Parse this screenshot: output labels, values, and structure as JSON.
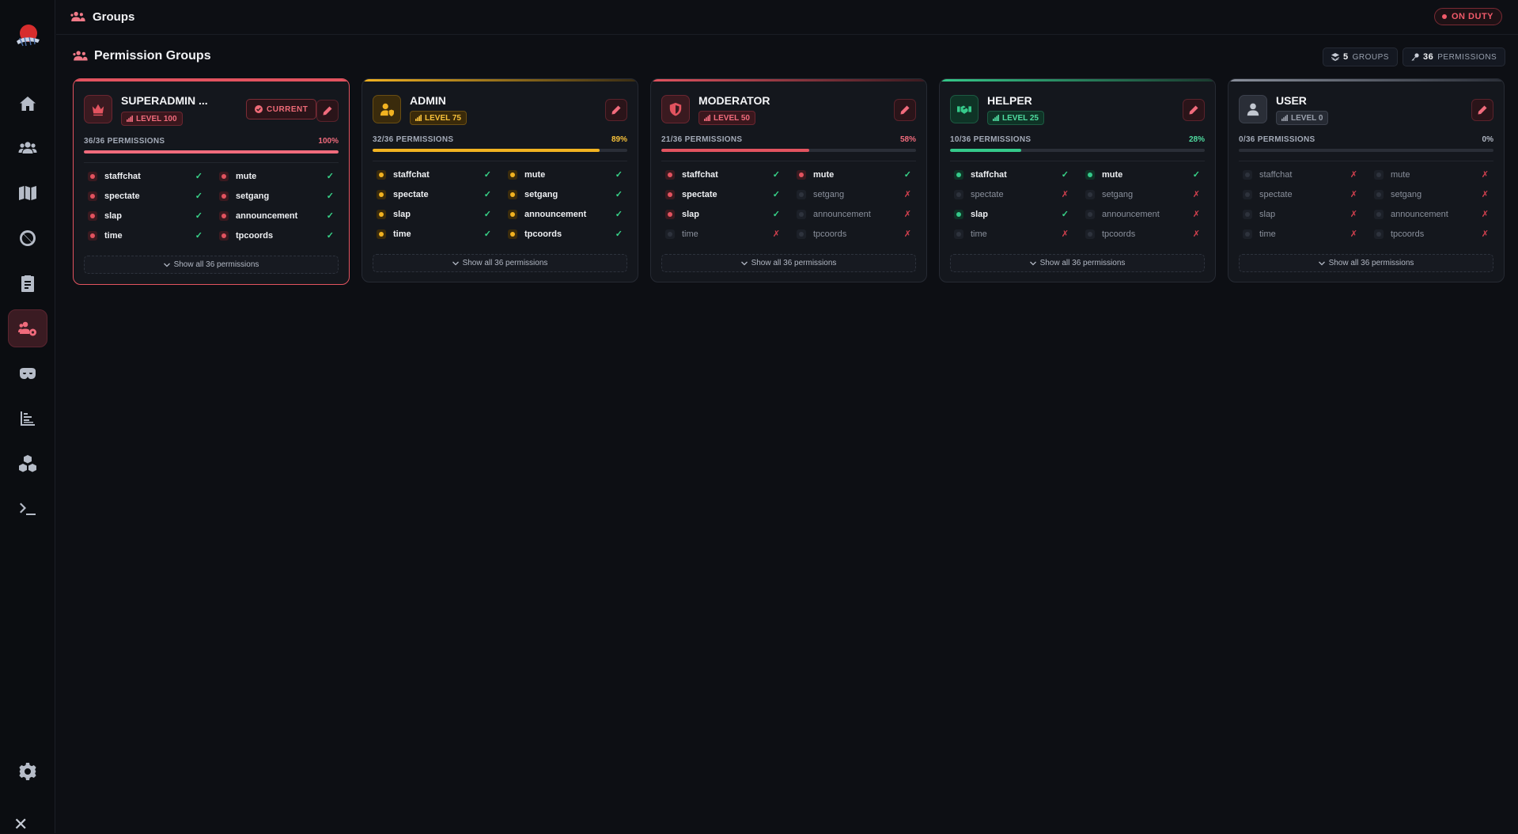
{
  "topbar": {
    "title": "Groups",
    "duty_label": "ON DUTY"
  },
  "section": {
    "title": "Permission Groups"
  },
  "stats": {
    "groups_count": "5",
    "groups_label": "GROUPS",
    "permissions_count": "36",
    "permissions_label": "PERMISSIONS"
  },
  "colors": {
    "accent": "#e2535f",
    "admin": "#f2b321",
    "moderator": "#e2535f",
    "helper": "#35c98a",
    "user": "#8a909c",
    "check": "#38d489",
    "cross": "#d2404e"
  },
  "sidebar": {
    "items": [
      {
        "icon": "home-icon"
      },
      {
        "icon": "users-icon"
      },
      {
        "icon": "map-icon"
      },
      {
        "icon": "ban-icon"
      },
      {
        "icon": "clipboard-icon"
      },
      {
        "icon": "user-group-cog-icon",
        "active": true
      },
      {
        "icon": "mask-icon"
      },
      {
        "icon": "chart-bar-icon"
      },
      {
        "icon": "cubes-icon"
      },
      {
        "icon": "terminal-icon"
      },
      {
        "icon": "gear-icon"
      }
    ]
  },
  "show_all_label": "Show all 36 permissions",
  "groups": [
    {
      "name": "SUPERADMIN ...",
      "level": "LEVEL 100",
      "current_label": "CURRENT",
      "perm_count": "36/36 PERMISSIONS",
      "percent": "100%",
      "fill": 1.0,
      "perms": [
        {
          "name": "staffchat",
          "on": true,
          "mark": "✓"
        },
        {
          "name": "mute",
          "on": true,
          "mark": "✓"
        },
        {
          "name": "spectate",
          "on": true,
          "mark": "✓"
        },
        {
          "name": "setgang",
          "on": true,
          "mark": "✓"
        },
        {
          "name": "slap",
          "on": true,
          "mark": "✓"
        },
        {
          "name": "announcement",
          "on": true,
          "mark": "✓"
        },
        {
          "name": "time",
          "on": true,
          "mark": "✓"
        },
        {
          "name": "tpcoords",
          "on": true,
          "mark": "✓"
        }
      ]
    },
    {
      "name": "ADMIN",
      "level": "LEVEL 75",
      "perm_count": "32/36 PERMISSIONS",
      "percent": "89%",
      "fill": 0.89,
      "perms": [
        {
          "name": "staffchat",
          "on": true,
          "mark": "✓"
        },
        {
          "name": "mute",
          "on": true,
          "mark": "✓"
        },
        {
          "name": "spectate",
          "on": true,
          "mark": "✓"
        },
        {
          "name": "setgang",
          "on": true,
          "mark": "✓"
        },
        {
          "name": "slap",
          "on": true,
          "mark": "✓"
        },
        {
          "name": "announcement",
          "on": true,
          "mark": "✓"
        },
        {
          "name": "time",
          "on": true,
          "mark": "✓"
        },
        {
          "name": "tpcoords",
          "on": true,
          "mark": "✓"
        }
      ]
    },
    {
      "name": "MODERATOR",
      "level": "LEVEL 50",
      "perm_count": "21/36 PERMISSIONS",
      "percent": "58%",
      "fill": 0.58,
      "perms": [
        {
          "name": "staffchat",
          "on": true,
          "mark": "✓"
        },
        {
          "name": "mute",
          "on": true,
          "mark": "✓"
        },
        {
          "name": "spectate",
          "on": true,
          "mark": "✓"
        },
        {
          "name": "setgang",
          "on": false,
          "mark": "✗"
        },
        {
          "name": "slap",
          "on": true,
          "mark": "✓"
        },
        {
          "name": "announcement",
          "on": false,
          "mark": "✗"
        },
        {
          "name": "time",
          "on": false,
          "mark": "✗"
        },
        {
          "name": "tpcoords",
          "on": false,
          "mark": "✗"
        }
      ]
    },
    {
      "name": "HELPER",
      "level": "LEVEL 25",
      "perm_count": "10/36 PERMISSIONS",
      "percent": "28%",
      "fill": 0.28,
      "perms": [
        {
          "name": "staffchat",
          "on": true,
          "mark": "✓"
        },
        {
          "name": "mute",
          "on": true,
          "mark": "✓"
        },
        {
          "name": "spectate",
          "on": false,
          "mark": "✗"
        },
        {
          "name": "setgang",
          "on": false,
          "mark": "✗"
        },
        {
          "name": "slap",
          "on": true,
          "mark": "✓"
        },
        {
          "name": "announcement",
          "on": false,
          "mark": "✗"
        },
        {
          "name": "time",
          "on": false,
          "mark": "✗"
        },
        {
          "name": "tpcoords",
          "on": false,
          "mark": "✗"
        }
      ]
    },
    {
      "name": "USER",
      "level": "LEVEL 0",
      "perm_count": "0/36 PERMISSIONS",
      "percent": "0%",
      "fill": 0.0,
      "perms": [
        {
          "name": "staffchat",
          "on": false,
          "mark": "✗"
        },
        {
          "name": "mute",
          "on": false,
          "mark": "✗"
        },
        {
          "name": "spectate",
          "on": false,
          "mark": "✗"
        },
        {
          "name": "setgang",
          "on": false,
          "mark": "✗"
        },
        {
          "name": "slap",
          "on": false,
          "mark": "✗"
        },
        {
          "name": "announcement",
          "on": false,
          "mark": "✗"
        },
        {
          "name": "time",
          "on": false,
          "mark": "✗"
        },
        {
          "name": "tpcoords",
          "on": false,
          "mark": "✗"
        }
      ]
    }
  ]
}
